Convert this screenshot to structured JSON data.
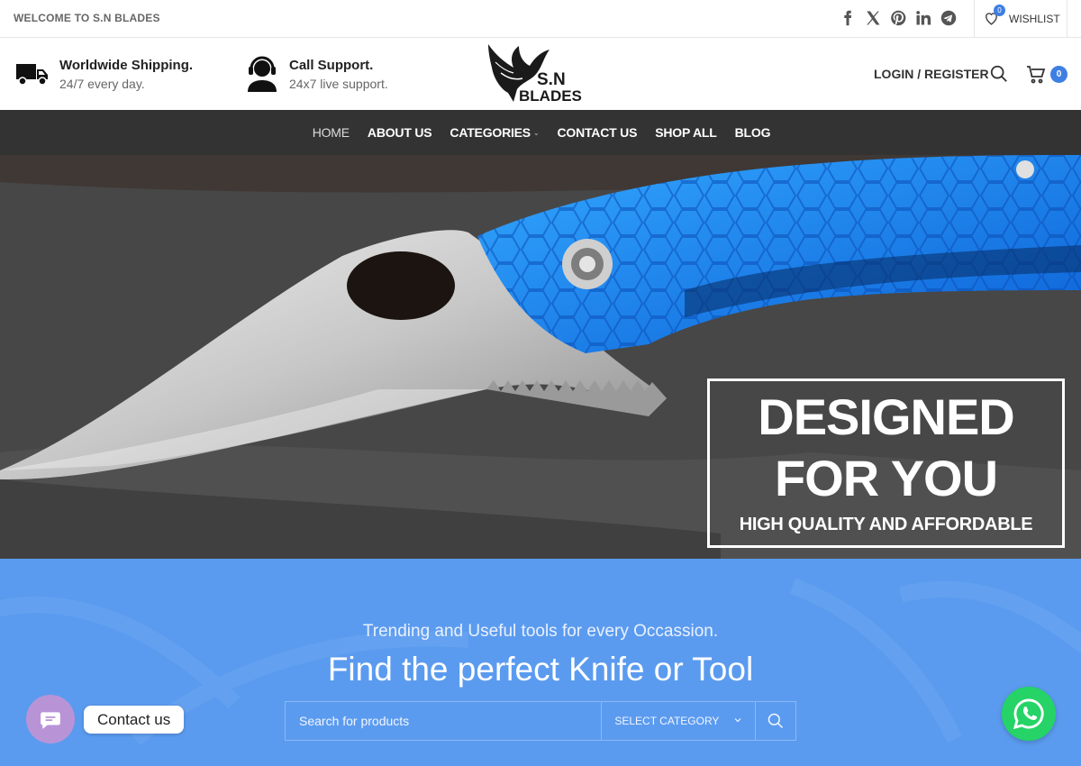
{
  "topbar": {
    "welcome": "WELCOME TO S.N BLADES",
    "socials": [
      "facebook-icon",
      "x-icon",
      "pinterest-icon",
      "linkedin-icon",
      "telegram-icon"
    ],
    "wishlist_count": "0",
    "wishlist_label": "WISHLIST"
  },
  "header": {
    "features": [
      {
        "icon": "truck-icon",
        "title": "Worldwide Shipping.",
        "subtitle": "24/7 every day."
      },
      {
        "icon": "support-agent-icon",
        "title": "Call Support.",
        "subtitle": "24x7 live support."
      }
    ],
    "logo": {
      "line1": "S.N",
      "line2": "BLADES"
    },
    "login_label": "LOGIN / REGISTER",
    "cart_count": "0"
  },
  "nav": {
    "items": [
      "HOME",
      "ABOUT US",
      "CATEGORIES",
      "CONTACT US",
      "SHOP ALL",
      "BLOG"
    ]
  },
  "hero": {
    "headline": "DESIGNED FOR YOU",
    "tagline": "HIGH QUALITY AND AFFORDABLE"
  },
  "find": {
    "subtitle": "Trending and Useful tools for every Occassion.",
    "title": "Find the perfect Knife or Tool",
    "search_placeholder": "Search for products",
    "category_label": "SELECT CATEGORY"
  },
  "widgets": {
    "contact_label": "Contact us"
  },
  "colors": {
    "accent": "#3e7fe3",
    "nav_bg": "#333333",
    "find_bg": "#5b9bef",
    "whatsapp": "#25d366"
  }
}
